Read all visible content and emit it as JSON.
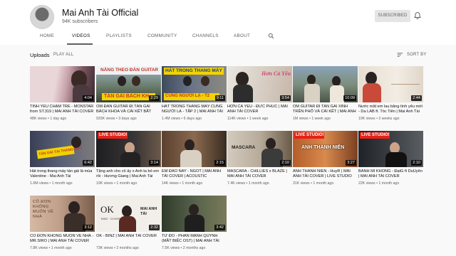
{
  "channel": {
    "name": "Mai Anh Tài Official",
    "subscribers": "94K subscribers",
    "subscribe_label": "SUBSCRIBED"
  },
  "tabs": [
    {
      "label": "HOME"
    },
    {
      "label": "VIDEOS"
    },
    {
      "label": "PLAYLISTS"
    },
    {
      "label": "COMMUNITY"
    },
    {
      "label": "CHANNELS"
    },
    {
      "label": "ABOUT"
    }
  ],
  "toolbar": {
    "uploads_label": "Uploads",
    "play_all_label": "PLAY ALL",
    "sort_label": "SORT BY"
  },
  "icons": {
    "bell": "bell-icon",
    "search": "search-icon",
    "sort": "sort-icon"
  },
  "videos": [
    {
      "title": "TÌNH YÊU CHẬM TRỄ - MONSTAR from ST.319 | MAI ANH TÀI COVER",
      "views": "48K views",
      "age": "1 day ago",
      "duration": "4:04",
      "overlay": ""
    },
    {
      "title": "ÔM ĐÀN GUITAR ĐI TÂN GÁI BÁCH KHOA VÀ CÁI KẾT BẤT NGỜ",
      "views": "933K views",
      "age": "3 days ago",
      "duration": "2:29",
      "overlay": "NÀNG THEO ĐÀN GUITAR",
      "overlay2": "TÁN GÁI BÁCH KH"
    },
    {
      "title": "HÁT TRONG THANG MÁY CÙNG NGƯỜI LẠ - TẬP 2 | MAI ANH TÀI",
      "views": "1.4M views",
      "age": "6 days ago",
      "duration": "9:11",
      "overlay": "HÁT TRONG THANG MÁY",
      "overlay2": "CÙNG NGƯỜI LẠ - T2"
    },
    {
      "title": "HƠN CẢ YÊU - ĐỨC PHÚC | MAI ANH TÀI COVER",
      "views": "114K views",
      "age": "1 week ago",
      "duration": "3:54",
      "overlay": "Hơn Cả Yêu"
    },
    {
      "title": "ÔM GUITAR ĐI TÂN GÁI XINH TRÊN PHỐ VÀ CÁI KẾT | MAI ANH TÀI",
      "views": "1M views",
      "age": "1 week ago",
      "duration": "10:09",
      "overlay": ""
    },
    {
      "title": "Nước mắt em lau bằng tình yêu mới - Da LAB ft. Tóc Tiên | Mai Anh Tài",
      "views": "19K views",
      "age": "2 weeks ago",
      "duration": "2:44",
      "overlay": ""
    },
    {
      "title": "Hát trong thang máy tán gái là mùa Valentine - Mai Anh Tài",
      "views": "1.6M views",
      "age": "1 month ago",
      "duration": "6:42",
      "overlay": "TÁN GÁI TẠI THANG MÁY"
    },
    {
      "title": "Tặng anh cho cô ấy x Anh ta bỏ em rồi - Hương Giang | Mai Anh Tài",
      "views": "19K views",
      "age": "1 month ago",
      "duration": "3:14",
      "overlay": "LIVE STUDIO!"
    },
    {
      "title": "EM ĐÃO NAY - NGOT | MAI ANH TÀI COVER | ACOUSTIC",
      "views": "14K views",
      "age": "1 month ago",
      "duration": "2:15",
      "overlay": ""
    },
    {
      "title": "MASCARA - CHILLIES x BLAZE | MAI ANH TÀI COVER",
      "views": "7.4K views",
      "age": "1 month ago",
      "duration": "2:10",
      "overlay": "MASCARA"
    },
    {
      "title": "ANH THANH NIÊN - HuyR | MAI ANH TÀI COVER | LIVE STUDIO",
      "views": "31K views",
      "age": "1 month ago",
      "duration": "3:27",
      "overlay": "LIVE STUDIO!",
      "overlay2": "ANH THANH NIÊN"
    },
    {
      "title": "BÁNH MÌ KHÔNG - ĐạtG ft DuUyên | MAI ANH TÀI COVER",
      "views": "22K views",
      "age": "1 month ago",
      "duration": "2:10",
      "overlay": "LIVE STUDIO!"
    },
    {
      "title": "CÔ ĐƠN KHÔNG MUỐN VỀ NHÀ - MR.SIRO | MAI ANH TÀI COVER",
      "views": "7.8K views",
      "age": "1 month ago",
      "duration": "3:12",
      "overlay": "CÔ ĐƠN KHÔNG MUỐN VỀ NHÀ"
    },
    {
      "title": "OK - BINZ | MAI ANH TÀI COVER",
      "views": "73K views",
      "age": "2 months ago",
      "duration": "2:32",
      "overlay": "OK",
      "overlay2": "BINZ · COVER",
      "overlay3": "MAI ANH TÀI"
    },
    {
      "title": "TỪ ĐÓ - PHAN MẠNH QUỲNH (MẮT BIẾC OST) | MAI ANH TÀI COVER",
      "views": "7.5K views",
      "age": "2 months ago",
      "duration": "3:42",
      "overlay": ""
    }
  ],
  "colors": {
    "page_bg": "#f9f9f9",
    "header_bg": "#ffffff",
    "text_primary": "#0f0f0f",
    "text_secondary": "#606060",
    "live_red": "#e62117"
  }
}
